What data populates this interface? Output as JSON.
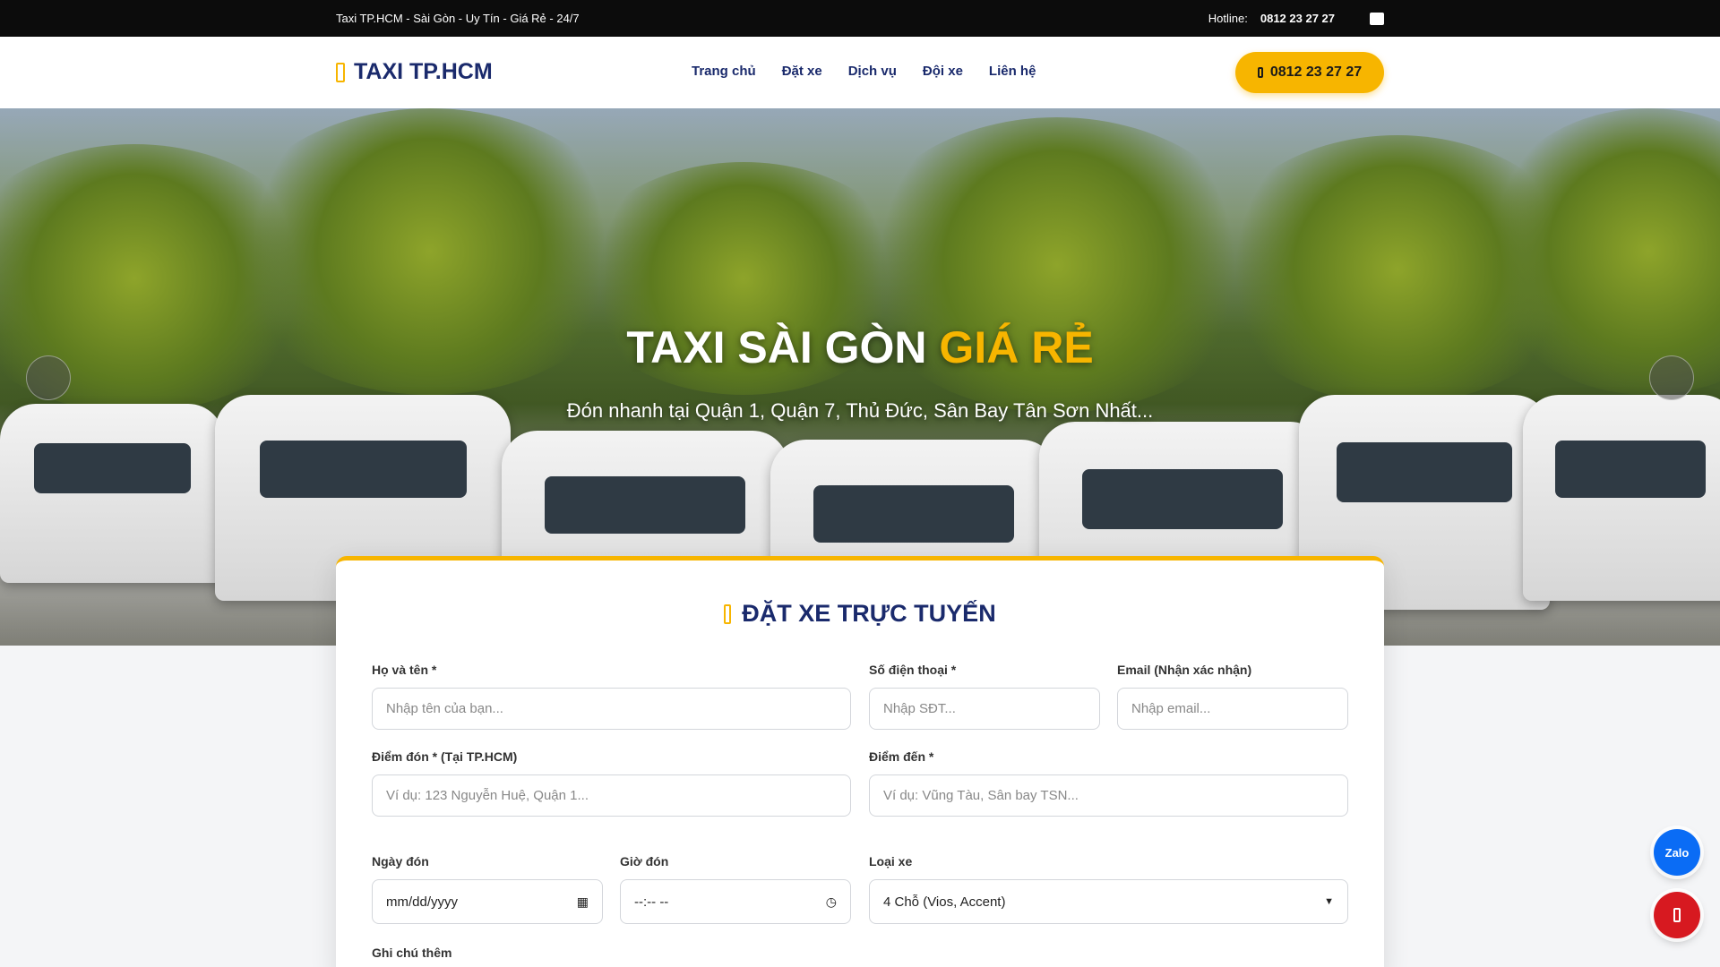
{
  "topbar": {
    "tagline": " Taxi TP.HCM - Sài Gòn - Uy Tín - Giá Rẻ - 24/7",
    "hotline_label": "Hotline:",
    "hotline_number": "0812 23 27 27",
    "facebook_icon": "",
    "icons": [
      "taxi-icon",
      "facebook-icon",
      "zalo-square-icon"
    ]
  },
  "header": {
    "logo": "TAXI TP.HCM",
    "nav": [
      "Trang chủ",
      "Đặt xe",
      "Dịch vụ",
      "Đội xe",
      "Liên hệ"
    ],
    "call_button": "0812 23 27 27"
  },
  "hero": {
    "title_main": "TAXI SÀI GÒN ",
    "title_accent": "GIÁ RẺ",
    "subtitle": "Đón nhanh tại Quận 1, Quận 7, Thủ Đức, Sân Bay Tân Sơn Nhất...",
    "prev_icon": "",
    "next_icon": ""
  },
  "booking": {
    "title": "ĐẶT XE TRỰC TUYẾN",
    "name_label": "Họ và tên *",
    "name_placeholder": "Nhập tên của bạn...",
    "phone_label": "Số điện thoại *",
    "phone_placeholder": "Nhập SĐT...",
    "email_label": "Email (Nhận xác nhận)",
    "email_placeholder": "Nhập email...",
    "pickup_label": "Điểm đón * (Tại TP.HCM)",
    "pickup_placeholder": "Ví dụ: 123 Nguyễn Huệ, Quận 1...",
    "dest_label": "Điểm đến *",
    "dest_placeholder": "Ví dụ: Vũng Tàu, Sân bay TSN...",
    "date_label": "Ngày đón",
    "date_value": "mm/dd/yyyy",
    "time_label": "Giờ đón",
    "time_value": "--:-- --",
    "car_label": "Loại xe",
    "car_value": "4 Chỗ (Vios, Accent)",
    "note_label": "Ghi chú thêm"
  },
  "floating": {
    "zalo": "Zalo"
  },
  "colors": {
    "accent": "#f7b500",
    "brand": "#1a2a6c",
    "zalo": "#0a6cf5",
    "call": "#d71920"
  }
}
